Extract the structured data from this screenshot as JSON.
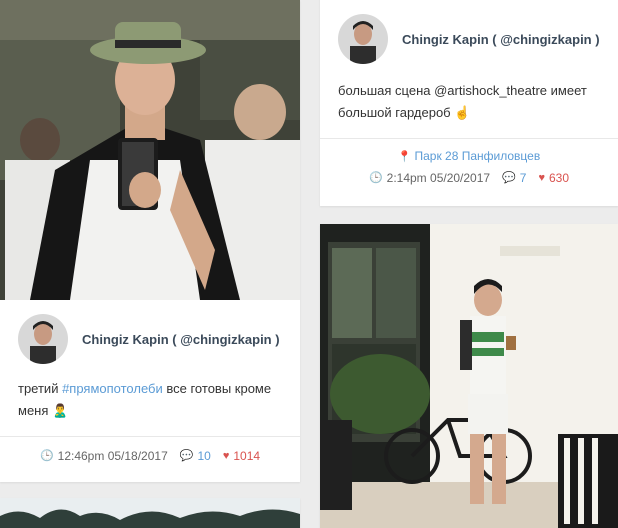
{
  "posts": [
    {
      "author": "Chingiz Kapin ( @chingizkapin )",
      "text_before": "третий ",
      "hashtag": "#прямопотолеби",
      "text_after": "  все готовы кроме меня 🙎‍♂️",
      "time": "12:46pm 05/18/2017",
      "comments": "10",
      "likes": "1014",
      "photo_desc": "mirror-selfie-hat"
    },
    {
      "author": "Chingiz Kapin ( @chingizkapin )",
      "text": "большая сцена @artishock_theatre имеет большой гардероб ☝️",
      "location": "Парк 28 Панфиловцев",
      "time": "2:14pm 05/20/2017",
      "comments": "7",
      "likes": "630"
    },
    {
      "photo_desc": "street-bicycle-coffee"
    }
  ],
  "colors": {
    "accent": "#5b9bd5",
    "like": "#d9534f",
    "author": "#3b4a5a"
  },
  "icons": {
    "time": "clock-icon",
    "comments": "comment-icon",
    "likes": "heart-icon",
    "location": "map-pin-icon"
  }
}
